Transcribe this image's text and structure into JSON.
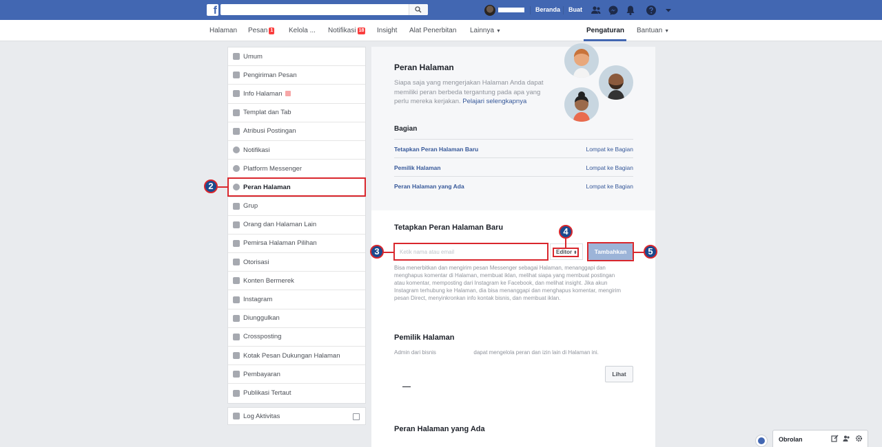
{
  "topbar": {
    "logo": "f",
    "search_placeholder": "",
    "links": [
      "Beranda",
      "Buat"
    ]
  },
  "pagenav": {
    "items": [
      {
        "label": "Halaman"
      },
      {
        "label": "Pesan",
        "badge": "1"
      },
      {
        "label": "Kelola ..."
      },
      {
        "label": "Notifikasi",
        "badge": "18"
      },
      {
        "label": "Insight"
      },
      {
        "label": "Alat Penerbitan"
      },
      {
        "label": "Lainnya"
      }
    ],
    "right": [
      "Pengaturan",
      "Bantuan"
    ]
  },
  "sidebar": {
    "items": [
      "Umum",
      "Pengiriman Pesan",
      "Info Halaman",
      "Templat dan Tab",
      "Atribusi Postingan",
      "Notifikasi",
      "Platform Messenger",
      "Peran Halaman",
      "Grup",
      "Orang dan Halaman Lain",
      "Pemirsa Halaman Pilihan",
      "Otorisasi",
      "Konten Bermerek",
      "Instagram",
      "Diunggulkan",
      "Crossposting",
      "Kotak Pesan Dukungan Halaman",
      "Pembayaran",
      "Publikasi Tertaut"
    ],
    "activity_log": "Log Aktivitas"
  },
  "annotations": [
    "2",
    "3",
    "4",
    "5"
  ],
  "main": {
    "title": "Peran Halaman",
    "desc_lines": [
      "Siapa saja yang mengerjakan Halaman Anda dapat",
      "memiliki peran berbeda tergantung pada apa yang",
      "perlu mereka kerjakan."
    ],
    "learn_more": "Pelajari selengkapnya",
    "sections_title": "Bagian",
    "sections": [
      {
        "label": "Tetapkan Peran Halaman Baru",
        "jump": "Lompat ke Bagian"
      },
      {
        "label": "Pemilik Halaman",
        "jump": "Lompat ke Bagian"
      },
      {
        "label": "Peran Halaman yang Ada",
        "jump": "Lompat ke Bagian"
      }
    ],
    "assign": {
      "title": "Tetapkan Peran Halaman Baru",
      "placeholder": "Ketik nama atau email",
      "role": "Editor",
      "button": "Tambahkan",
      "help_lines": [
        "Bisa menerbitkan dan mengirim pesan Messenger sebagai Halaman, menanggapi dan",
        "menghapus komentar di Halaman, membuat iklan, melihat siapa yang membuat postingan",
        "atau komentar, memposting dari Instagram ke Facebook, dan melihat insight. Jika akun",
        "Instagram terhubung ke Halaman, dia bisa menanggapi dan menghapus komentar, mengirim",
        "pesan Direct, menyinkronkan info kontak bisnis, dan membuat iklan."
      ]
    },
    "owner": {
      "title": "Pemilik Halaman",
      "desc_left": "Admin dari bisnis",
      "desc_right": "dapat mengelola peran dan izin lain di Halaman ini.",
      "view_button": "Lihat"
    },
    "existing_title": "Peran Halaman yang Ada"
  },
  "chat": {
    "label": "Obrolan"
  }
}
